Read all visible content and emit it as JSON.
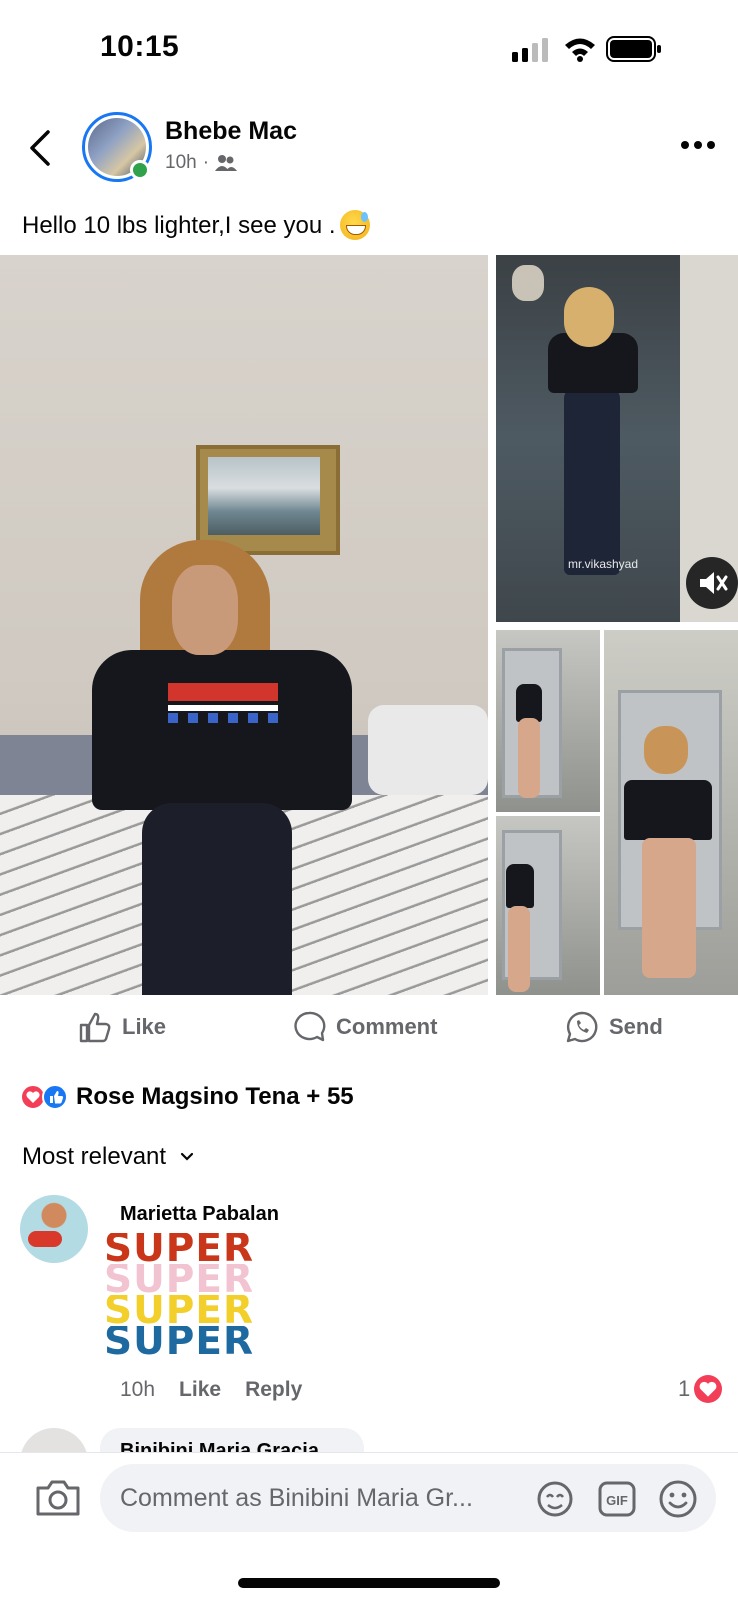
{
  "status_bar": {
    "time": "10:15"
  },
  "post": {
    "author": "Bhebe Mac",
    "time": "10h",
    "audience_icon": "friends-icon",
    "caption": "Hello 10 lbs lighter,I see you .",
    "emoji": "sweat-smile-emoji",
    "watermark": "mr.vikashyad"
  },
  "actions": {
    "like": "Like",
    "comment": "Comment",
    "send": "Send"
  },
  "reactions": {
    "summary": "Rose Magsino Tena + 55"
  },
  "sort": {
    "label": "Most relevant"
  },
  "comments": [
    {
      "author": "Marietta Pabalan",
      "sticker_words": [
        "SUPER",
        "SUPER",
        "SUPER",
        "SUPER"
      ],
      "sticker_colors": [
        "#c9361a",
        "#f2c3d1",
        "#f2cf2a",
        "#1e6aa0"
      ],
      "time": "10h",
      "like": "Like",
      "reply": "Reply",
      "reaction_count": "1"
    },
    {
      "author": "Binibini Maria Gracia"
    }
  ],
  "composer": {
    "placeholder": "Comment as Binibini Maria Gr..."
  },
  "colors": {
    "accent": "#1877f2",
    "online": "#31a24c",
    "love": "#f33e58"
  }
}
